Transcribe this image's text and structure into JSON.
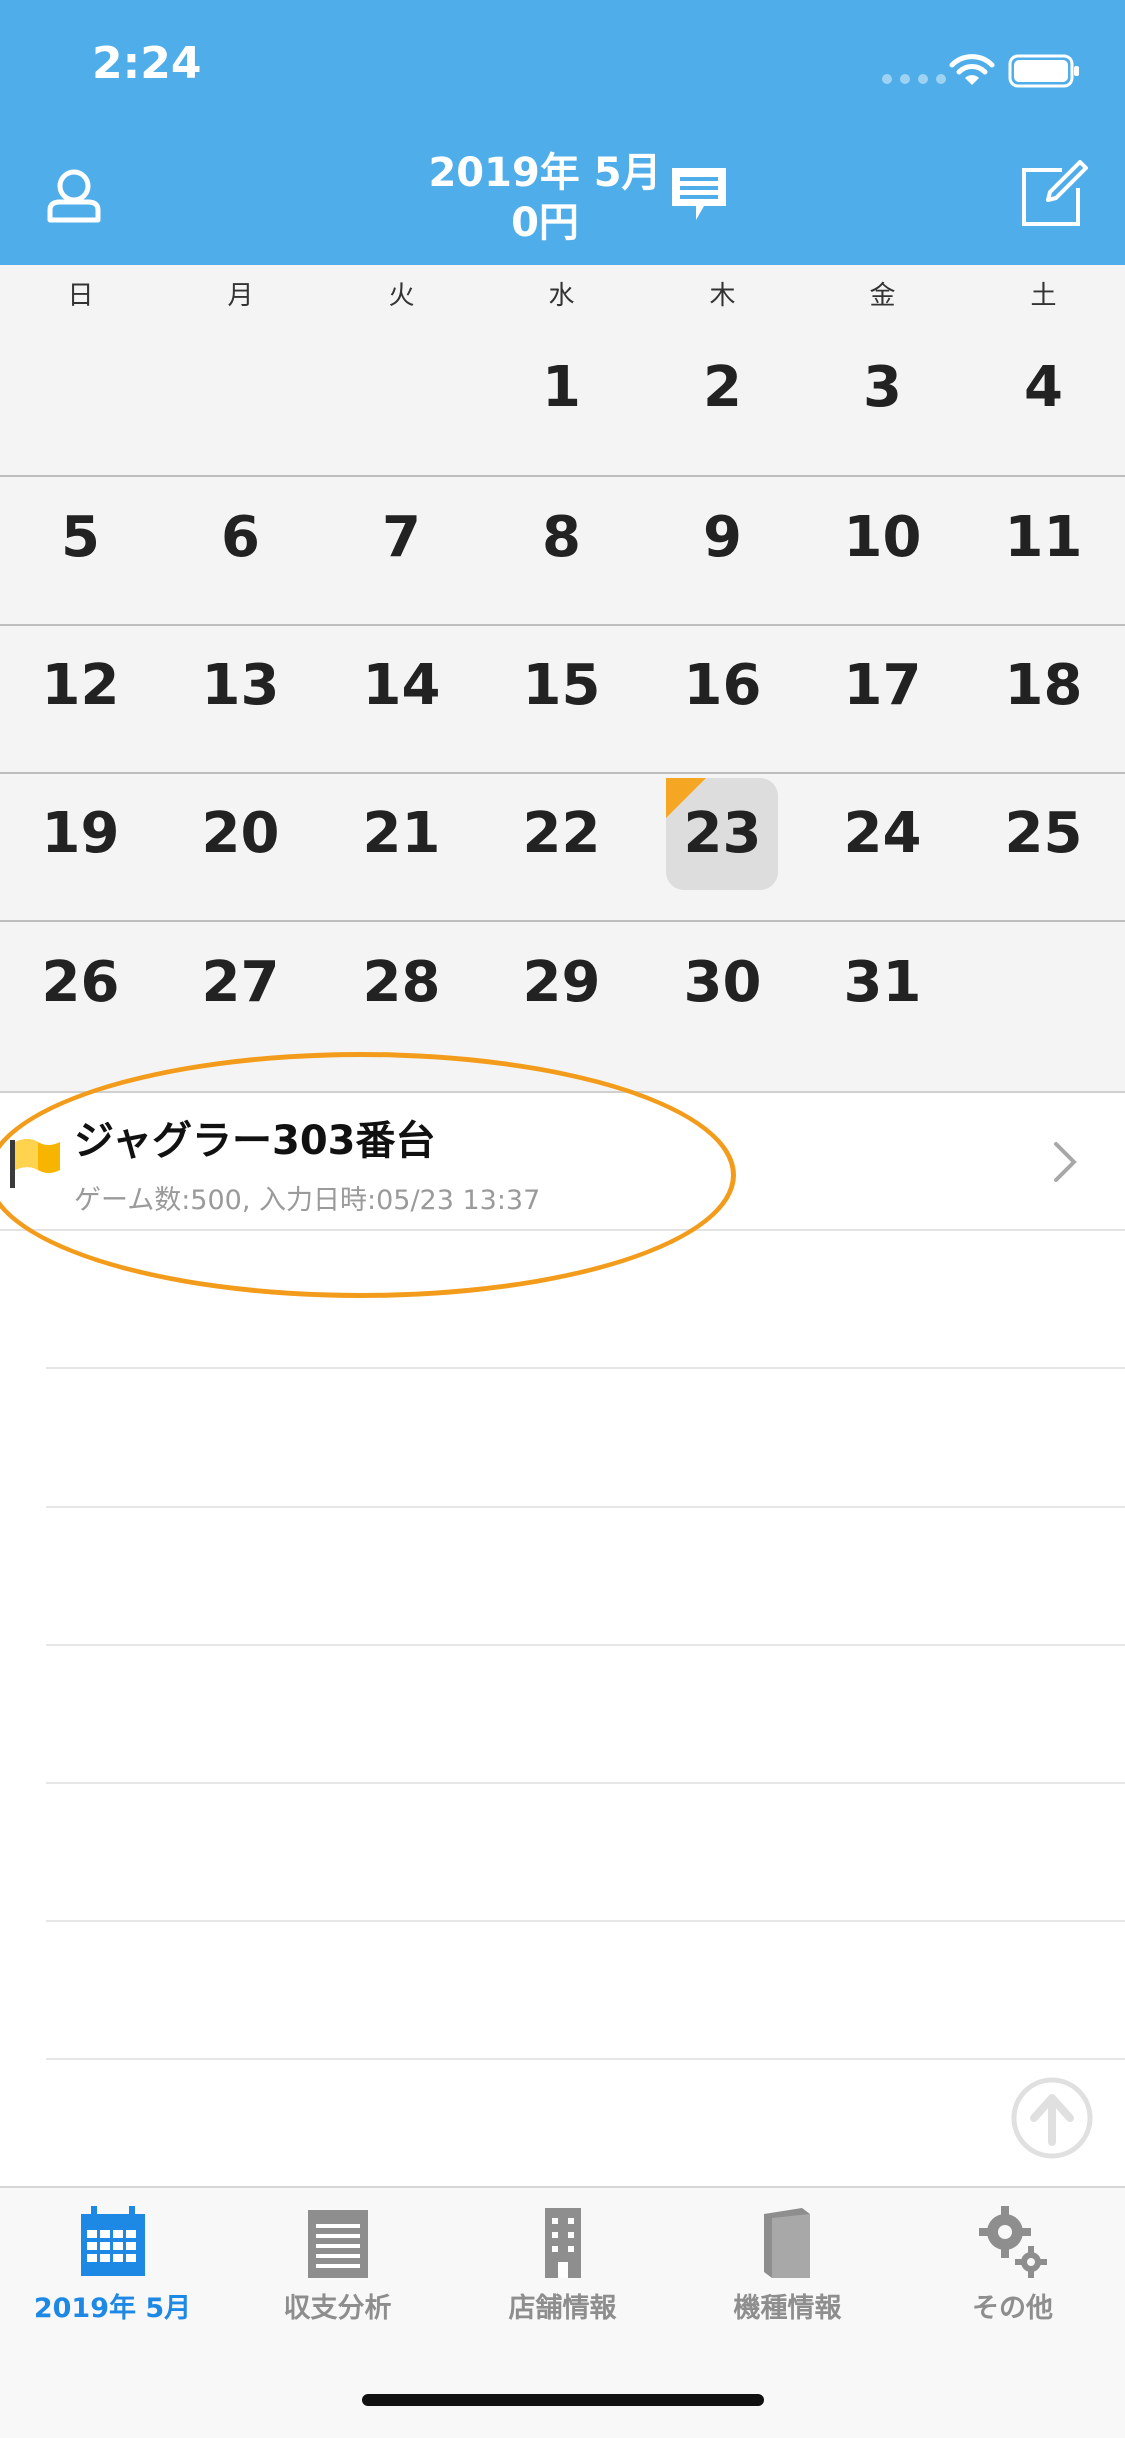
{
  "status_bar": {
    "time": "2:24"
  },
  "header": {
    "year_month": "2019年 5月",
    "balance": "0円"
  },
  "calendar": {
    "weekdays": [
      "日",
      "月",
      "火",
      "水",
      "木",
      "金",
      "土"
    ],
    "weeks": [
      [
        "",
        "",
        "",
        "1",
        "2",
        "3",
        "4"
      ],
      [
        "5",
        "6",
        "7",
        "8",
        "9",
        "10",
        "11"
      ],
      [
        "12",
        "13",
        "14",
        "15",
        "16",
        "17",
        "18"
      ],
      [
        "19",
        "20",
        "21",
        "22",
        "23",
        "24",
        "25"
      ],
      [
        "26",
        "27",
        "28",
        "29",
        "30",
        "31",
        ""
      ]
    ],
    "selected_day": "23"
  },
  "entries": [
    {
      "title": "ジャグラー303番台",
      "subtitle": "ゲーム数:500, 入力日時:05/23 13:37"
    }
  ],
  "tabs": [
    {
      "label": "2019年 5月",
      "icon": "calendar-icon",
      "active": true
    },
    {
      "label": "収支分析",
      "icon": "notepad-icon",
      "active": false
    },
    {
      "label": "店舗情報",
      "icon": "building-icon",
      "active": false
    },
    {
      "label": "機種情報",
      "icon": "book-icon",
      "active": false
    },
    {
      "label": "その他",
      "icon": "gears-icon",
      "active": false
    }
  ],
  "colors": {
    "header": "#4FAEEA",
    "active_tab": "#1E88E5",
    "highlight": "#F39C1B",
    "today_marker": "#F5A623"
  }
}
